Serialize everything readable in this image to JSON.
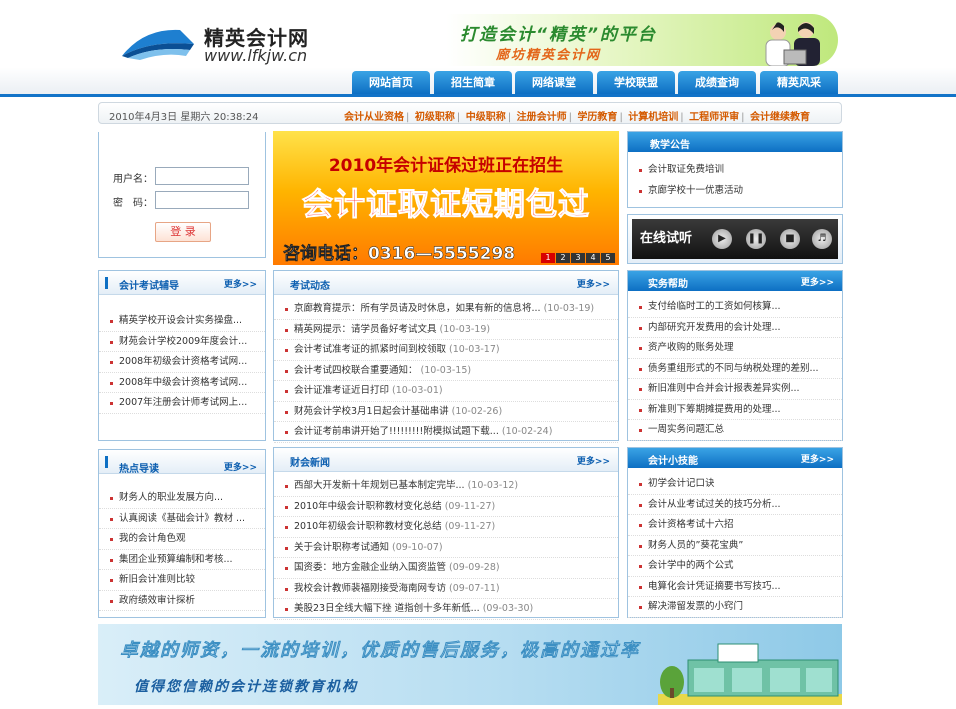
{
  "header": {
    "site_name": "精英会计网",
    "site_url": "www.lfkjw.cn",
    "slogan_main": "打造会计“精英”的平台",
    "slogan_sub": "廊坊精英会计网"
  },
  "nav": [
    "网站首页",
    "招生简章",
    "网络课堂",
    "学校联盟",
    "成绩查询",
    "精英风采"
  ],
  "datebar": {
    "datetime": "2010年4月3日  星期六  20:38:24",
    "quick_links": [
      "会计从业资格",
      "初级职称",
      "中级职称",
      "注册会计师",
      "学历教育",
      "计算机培训",
      "工程师评审",
      "会计继续教育"
    ]
  },
  "login": {
    "username_label": "用户名：",
    "password_label": "密　码：",
    "username_value": "",
    "password_value": "",
    "submit_label": "登 录"
  },
  "promo": {
    "line1": "2010年会计证保过班正在招生",
    "line2": "会计证取证短期包过",
    "line3": "咨询电话：0316—5555298",
    "pages": [
      "1",
      "2",
      "3",
      "4",
      "5"
    ]
  },
  "notice": {
    "title": "教学公告",
    "items": [
      "会计取证免费培训",
      "京廊学校十一优惠活动"
    ]
  },
  "player": {
    "label": "在线试听",
    "sub_label": "在线试听"
  },
  "exam_guide": {
    "title": "会计考试辅导",
    "more": "更多>>",
    "items": [
      "精英学校开设会计实务操盘...",
      "财苑会计学校2009年度会计...",
      "2008年初级会计资格考试网...",
      "2008年中级会计资格考试网...",
      "2007年注册会计师考试网上..."
    ]
  },
  "hot_topics": {
    "title": "热点导读",
    "more": "更多>>",
    "items": [
      "财务人的职业发展方向...",
      "认真阅读《基础会计》教材 ...",
      "我的会计角色观",
      "集团企业预算编制和考核...",
      "新旧会计准则比较",
      "政府绩效审计探析"
    ]
  },
  "exam_news": {
    "title": "考试动态",
    "more": "更多>>",
    "items": [
      {
        "text": "京廊教育提示：所有学员请及时休息，如果有新的信息将...",
        "date": "(10-03-19)"
      },
      {
        "text": "精英网提示：请学员备好考试文具",
        "date": "(10-03-19)"
      },
      {
        "text": "会计考试准考证的抓紧时间到校领取",
        "date": "(10-03-17)"
      },
      {
        "text": "会计考试四校联合重要通知：",
        "date": "(10-03-15)"
      },
      {
        "text": "会计证准考证近日打印",
        "date": "(10-03-01)"
      },
      {
        "text": "财苑会计学校3月1日起会计基础串讲",
        "date": "(10-02-26)"
      },
      {
        "text": "会计证考前串讲开始了!!!!!!!!!附模拟试题下载...",
        "date": "(10-02-24)"
      }
    ]
  },
  "finance_news": {
    "title": "财会新闻",
    "more": "更多>>",
    "items": [
      {
        "text": "西部大开发新十年规划已基本制定完毕...",
        "date": "(10-03-12)"
      },
      {
        "text": "2010年中级会计职称教材变化总结",
        "date": "(09-11-27)"
      },
      {
        "text": "2010年初级会计职称教材变化总结",
        "date": "(09-11-27)"
      },
      {
        "text": "关于会计职称考试通知",
        "date": "(09-10-07)"
      },
      {
        "text": "国资委：地方金融企业纳入国资监管",
        "date": "(09-09-28)"
      },
      {
        "text": "我校会计教师裴福刚接受海南网专访",
        "date": "(09-07-11)"
      },
      {
        "text": "美股23日全线大幅下挫 道指创十多年新低...",
        "date": "(09-03-30)"
      }
    ]
  },
  "practice_help": {
    "title": "实务帮助",
    "more": "更多>>",
    "items": [
      "支付给临时工的工资如何核算...",
      "内部研究开发费用的会计处理...",
      "资产收购的账务处理",
      "债务重组形式的不同与纳税处理的差别...",
      "新旧准则中合并会计报表差异实例...",
      "新准则下筹期摊提费用的处理...",
      "一周实务问题汇总"
    ]
  },
  "tips": {
    "title": "会计小技能",
    "more": "更多>>",
    "items": [
      "初学会计记口诀",
      "会计从业考试过关的技巧分析...",
      "会计资格考试十六招",
      "财务人员的”葵花宝典”",
      "会计学中的两个公式",
      "电算化会计凭证摘要书写技巧...",
      "解决滞留发票的小窍门"
    ]
  },
  "bottom_banner": {
    "line1": "卓越的师资，一流的培训，优质的售后服务，极高的通过率",
    "line2": "值得您信赖的会计连锁教育机构"
  },
  "colors": {
    "nav_blue": "#0d6fc3",
    "accent_orange": "#d45a00",
    "promo_red": "#ff1b1b"
  }
}
